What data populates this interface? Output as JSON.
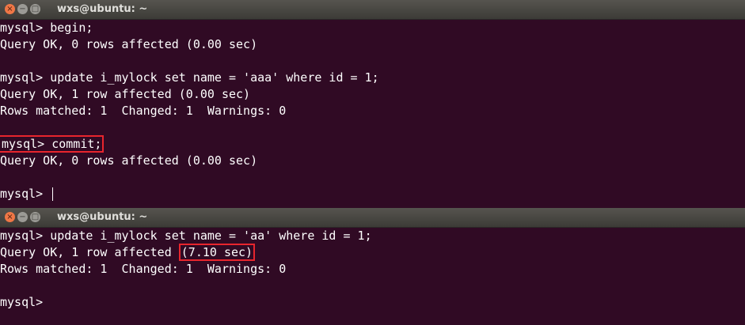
{
  "top_window": {
    "title": "wxs@ubuntu: ~",
    "lines": [
      "mysql> begin;",
      "Query OK, 0 rows affected (0.00 sec)",
      "",
      "mysql> update i_mylock set name = 'aaa' where id = 1;",
      "Query OK, 1 row affected (0.00 sec)",
      "Rows matched: 1  Changed: 1  Warnings: 0",
      "",
      "mysql> commit;",
      "Query OK, 0 rows affected (0.00 sec)",
      "",
      "mysql> "
    ]
  },
  "bottom_window": {
    "title": "wxs@ubuntu: ~",
    "lines": {
      "update_cmd": "mysql> update i_mylock set name = 'aa' where id = 1;",
      "query_ok_prefix": "Query OK, 1 row affected ",
      "elapsed": "(7.10 sec)",
      "rows_matched": "Rows matched: 1  Changed: 1  Warnings: 0",
      "blank": "",
      "prompt": "mysql> "
    }
  },
  "colors": {
    "terminal_bg": "#300a24",
    "highlight_border": "#e8252d",
    "close_button": "#f07746"
  },
  "icons": [
    "close-icon",
    "minimize-icon",
    "maximize-icon"
  ]
}
